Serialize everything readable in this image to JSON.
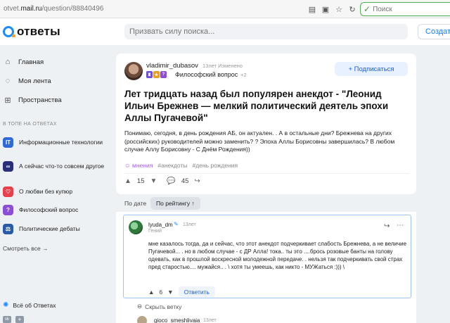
{
  "browser": {
    "url_prefix": "otvet.",
    "url_domain": "mail.ru",
    "url_path": "/question/88840496",
    "search_placeholder": "Поиск"
  },
  "header": {
    "logo_text": "ответы",
    "search_placeholder": "Призвать силу поиска...",
    "create_label": "Создать"
  },
  "sidebar": {
    "nav": [
      {
        "label": "Главная",
        "icon": "home-icon"
      },
      {
        "label": "Моя лента",
        "icon": "feed-icon"
      },
      {
        "label": "Пространства",
        "icon": "spaces-icon"
      }
    ],
    "section_title": "В ТОПЕ НА ОТВЕТАХ",
    "topics": [
      {
        "label": "Информационные технологии",
        "color": "#2f6bd8",
        "glyph": "IT"
      },
      {
        "label": "А сейчас что-то совсем другое",
        "color": "#2a2f7a",
        "glyph": "∞"
      },
      {
        "label": "О любви без купюр",
        "color": "#e8404a",
        "glyph": "♡"
      },
      {
        "label": "Философский вопрос",
        "color": "#8a4fd6",
        "glyph": "?"
      },
      {
        "label": "Политические дебаты",
        "color": "#2a5aa8",
        "glyph": "⚖"
      }
    ],
    "see_all": "Смотреть все →",
    "all_about": "Всё об Ответах",
    "socials": [
      "vk",
      "tg"
    ]
  },
  "question": {
    "author": "vladimir_dubasov",
    "time": "13лет Изменено",
    "category": "Философский вопрос",
    "category_extra": "+2",
    "subscribe_label": "+ Подписаться",
    "title": "Лет тридцать назад был популярен анекдот - \"Леонид Ильич Брежнев — мелкий политический деятель эпохи Аллы Пугачевой\"",
    "body": "Понимаю, сегодня, в день рождения АБ, он актуален. . А в остальные дни? Брежнева на других (российских) руководителей можно заменить? ? Эпоха Аллы Борисовны завершилась? В любом случае Аллу Борисовну - С Днём Рождения))",
    "tags": [
      "мнения",
      "#анекдоты",
      "#день рождения"
    ],
    "votes": "15",
    "comments": "45",
    "badge_colors": [
      "#6c4fd6",
      "#e8a020",
      "#8a4fd6"
    ]
  },
  "answers": {
    "sort_date": "По дате",
    "sort_rating": "По рейтингу ↑",
    "first": {
      "author": "lyuda_dm",
      "time": "13лет",
      "rank": "Гений",
      "text": "мне казалось тогда, да и сейчас, что этот анекдот подчеркивает слабость Брежнева, а не величие Пугачевой... . но в любом случае - с ДР Алла! тока.. ты это ....брось розовые банты на голову одевать, как в прошлой воскресной молодежной передаче. . нельзя так подчеркивать свой страх пред старостью.... мужайся.. . \\ хотя ты умеешь, как никто - МУЖаться :))) \\",
      "votes": "6",
      "reply_label": "Ответить"
    },
    "hide_branch": "Скрыть ветку",
    "second": {
      "author": "gioco_smeshlivaia",
      "time": "13лет"
    }
  }
}
